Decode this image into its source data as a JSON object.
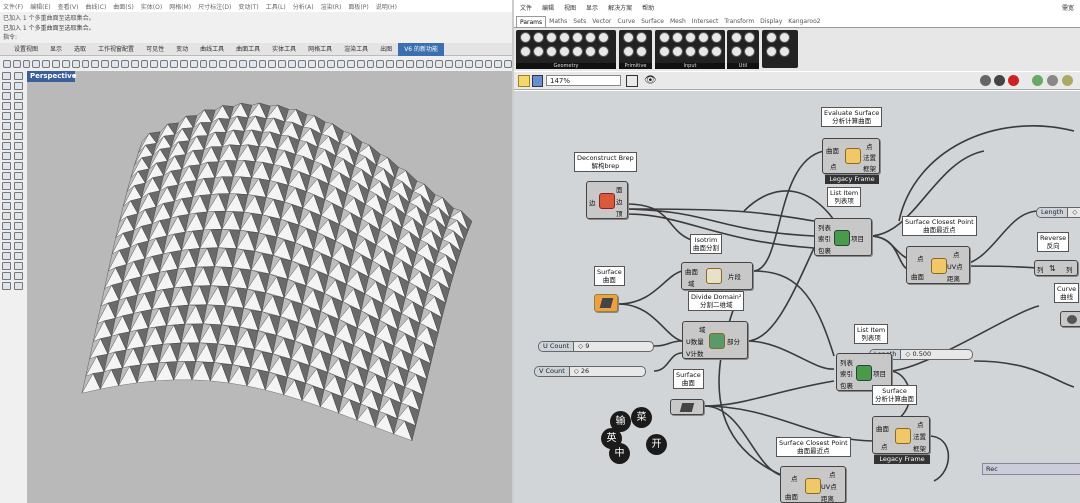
{
  "rhino": {
    "menu": [
      "文件(F)",
      "编辑(E)",
      "查看(V)",
      "曲线(C)",
      "曲面(S)",
      "实体(O)",
      "网格(M)",
      "尺寸标注(D)",
      "变动(T)",
      "工具(L)",
      "分析(A)",
      "渲染(R)",
      "面板(P)",
      "说明(H)"
    ],
    "cmd_line1": "已加入 1 个多重曲面至选取集合。",
    "cmd_line2": "已加入 1 个多重曲面至选取集合。",
    "cmd_prompt": "指令:",
    "tabs": [
      "设置视图",
      "显示",
      "选取",
      "工作视窗配置",
      "可见性",
      "变动",
      "曲线工具",
      "曲面工具",
      "实体工具",
      "网格工具",
      "渲染工具",
      "出图",
      "V6 的新功能"
    ],
    "viewport_label": "Perspective"
  },
  "gh": {
    "menu": [
      "文件",
      "编辑",
      "视图",
      "显示",
      "解决方案",
      "帮助"
    ],
    "user": "需宽",
    "tabs": [
      "Params",
      "Maths",
      "Sets",
      "Vector",
      "Curve",
      "Surface",
      "Mesh",
      "Intersect",
      "Transform",
      "Display",
      "Kangaroo2"
    ],
    "ribbon_groups": [
      "Geometry",
      "Primitive",
      "Input",
      "Util"
    ],
    "zoom": "147%",
    "labels": {
      "evaluate_surface": [
        "Evaluate Surface",
        "分析计算曲面"
      ],
      "deconstruct_brep": [
        "Deconstruct Brep",
        "解构brep"
      ],
      "list_item1": [
        "List Item",
        "列表项"
      ],
      "surface_closest1": [
        "Surface Closest Point",
        "曲面最近点"
      ],
      "isotrim": [
        "Isotrim",
        "曲面分割"
      ],
      "surface1": [
        "Surface",
        "曲面"
      ],
      "divide_domain": [
        "Divide Domain²",
        "分割二维域"
      ],
      "reverse": [
        "Reverse",
        "反向"
      ],
      "curve": [
        "Curve",
        "曲线"
      ],
      "list_item2": [
        "List Item",
        "列表项"
      ],
      "surface2": [
        "Surface",
        "曲面"
      ],
      "evaluate_surface2": [
        "Surface",
        "分析计算曲面"
      ],
      "surface_closest2": [
        "Surface Closest Point",
        "曲面最近点"
      ]
    },
    "ports": {
      "eval_in": [
        "曲面",
        "点"
      ],
      "eval_out": [
        "点",
        "法置",
        "框架"
      ],
      "decon_in": "边",
      "decon_out": [
        "面",
        "边",
        "顶"
      ],
      "list_in": [
        "列表",
        "索引",
        "包裹"
      ],
      "list_out": "项目",
      "closest_in": [
        "点",
        "曲面"
      ],
      "closest_out": [
        "点",
        "UV点",
        "距离"
      ],
      "iso_in": [
        "曲面",
        "域"
      ],
      "iso_out": "片段",
      "divide_in": [
        "域",
        "U数量",
        "V计数"
      ],
      "divide_out": "部分",
      "list2_in": [
        "列表",
        "索引",
        "包裹"
      ],
      "list2_out": "项目",
      "eval2_in": [
        "曲面",
        "点"
      ],
      "eval2_out": [
        "点",
        "法置",
        "框架"
      ],
      "closest2_in": [
        "点",
        "曲面"
      ],
      "closest2_out": [
        "点",
        "UV点",
        "距离"
      ]
    },
    "legacy": "Legacy Frame",
    "sliders": {
      "u_count": {
        "name": "U Count",
        "value": "9"
      },
      "v_count": {
        "name": "V Count",
        "value": "26"
      },
      "length1": {
        "name": "Length",
        "value": "0.500"
      },
      "length2": {
        "name": "Length",
        "value": ""
      }
    },
    "ime": [
      "输",
      "菜",
      "英",
      "开",
      "中"
    ],
    "rec": "Rec"
  },
  "colors": {
    "rhino_viewport": "#b9b9b9",
    "gh_canvas": "#d2d5d8",
    "component": "#c8c8c8",
    "wire": "#3a3a3a",
    "tab_active": "#3a6fb0"
  }
}
